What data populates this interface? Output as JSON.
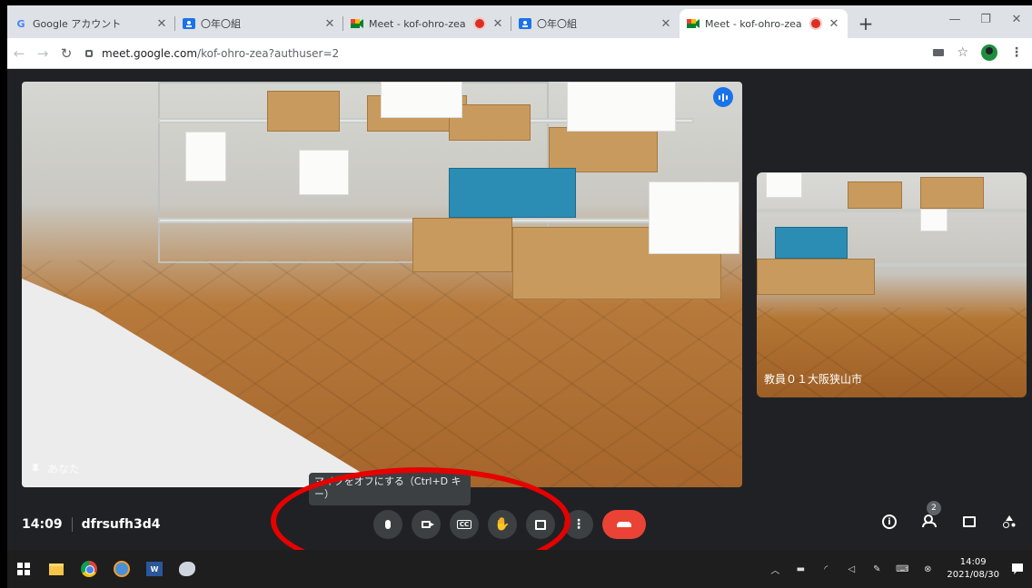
{
  "browser": {
    "tabs": [
      {
        "favicon": "G",
        "favicon_color": "#4285f4",
        "title": "Google アカウント",
        "recording": false,
        "active": false
      },
      {
        "favicon": "classroom-icon",
        "favicon_color": "#1a73e8",
        "title": "〇年〇組",
        "recording": false,
        "active": false
      },
      {
        "favicon": "meet-icon",
        "favicon_color": "#00832d",
        "title": "Meet - kof-ohro-zea",
        "recording": true,
        "active": false
      },
      {
        "favicon": "classroom-icon",
        "favicon_color": "#1a73e8",
        "title": "〇年〇組",
        "recording": false,
        "active": false
      },
      {
        "favicon": "meet-icon",
        "favicon_color": "#00832d",
        "title": "Meet - kof-ohro-zea",
        "recording": true,
        "active": true
      }
    ],
    "url_host": "meet.google.com",
    "url_path": "/kof-ohro-zea?authuser=2"
  },
  "meet": {
    "main_tile_name": "あなた",
    "side_tile_name": "教員０１大阪狭山市",
    "tooltip": "マイクをオフにする（Ctrl+D キー）",
    "time": "14:09",
    "meeting_code": "dfrsufh3d4",
    "participants_count": "2"
  },
  "taskbar": {
    "clock_time": "14:09",
    "clock_date": "2021/08/30",
    "word_label": "W"
  },
  "colors": {
    "end_call": "#ea4335",
    "annotation": "#e60000",
    "speaking_badge": "#1a73e8"
  }
}
